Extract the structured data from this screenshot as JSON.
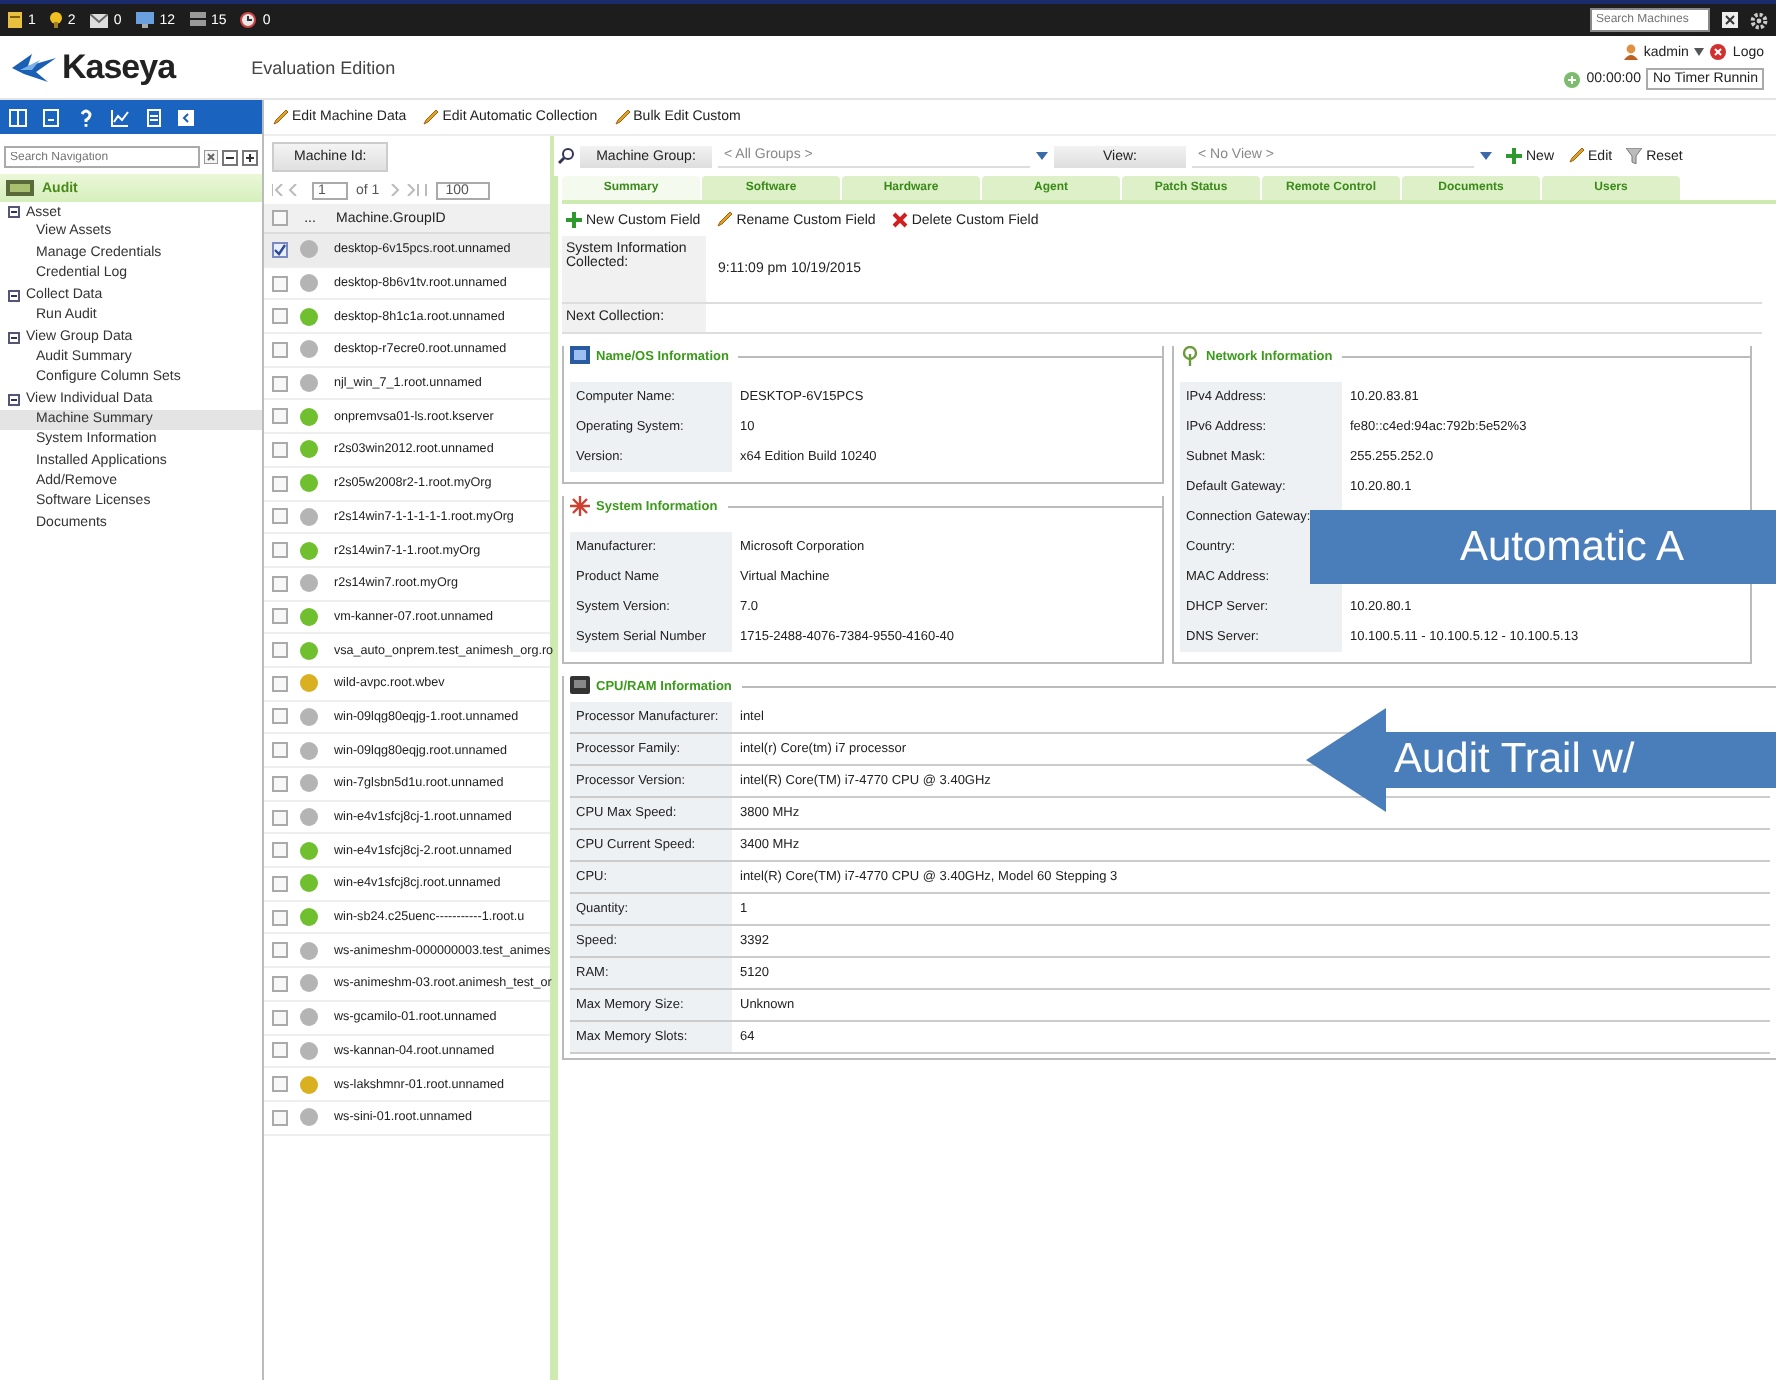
{
  "top_bar": {
    "counters": [
      {
        "kind": "note",
        "count": "1"
      },
      {
        "kind": "bulb",
        "count": "2"
      },
      {
        "kind": "mail",
        "count": "0"
      },
      {
        "kind": "monitor",
        "count": "12"
      },
      {
        "kind": "server",
        "count": "15"
      },
      {
        "kind": "alarm",
        "count": "0"
      }
    ],
    "search": {
      "placeholder": "Search Machines"
    }
  },
  "header": {
    "logo": "Kaseya",
    "edition": "Evaluation Edition",
    "user": "kadmin",
    "logout": "Logo",
    "timer": "00:00:00",
    "timer_status": "No Timer Runnin"
  },
  "toolbar": [
    {
      "label": "Edit Machine Data",
      "kind": "edit"
    },
    {
      "label": "Edit Automatic Collection",
      "kind": "edit"
    },
    {
      "label": "Bulk Edit Custom",
      "kind": "edit"
    }
  ],
  "navigation": {
    "search": {
      "placeholder": "Search Navigation"
    },
    "module": "Audit",
    "items": [
      {
        "label": "Asset",
        "expanded": true,
        "children": [
          {
            "label": "View Assets",
            "selected": false
          },
          {
            "label": "Manage Credentials",
            "selected": false
          },
          {
            "label": "Credential Log",
            "selected": false
          }
        ]
      },
      {
        "label": "Collect Data",
        "expanded": true,
        "children": [
          {
            "label": "Run Audit",
            "selected": false
          }
        ]
      },
      {
        "label": "View Group Data",
        "expanded": true,
        "children": [
          {
            "label": "Audit Summary",
            "selected": false
          },
          {
            "label": "Configure Column Sets",
            "selected": false
          }
        ]
      },
      {
        "label": "View Individual Data",
        "expanded": true,
        "children": [
          {
            "label": "Machine Summary",
            "selected": true
          },
          {
            "label": "System Information",
            "selected": false
          },
          {
            "label": "Installed Applications",
            "selected": false
          },
          {
            "label": "Add/Remove",
            "selected": false
          },
          {
            "label": "Software Licenses",
            "selected": false
          },
          {
            "label": "Documents",
            "selected": false
          }
        ]
      }
    ]
  },
  "machine_list": {
    "filter_label": "Machine Id:",
    "page": "1",
    "page_count": "of 1",
    "page_size": "100",
    "all_checked": false,
    "columns": [
      "...",
      "Machine.GroupID"
    ],
    "rows": [
      {
        "name": "desktop-6v15pcs.root.unnamed",
        "checked": true,
        "selected": true,
        "color": "#b4b4b4"
      },
      {
        "name": "desktop-8b6v1tv.root.unnamed",
        "checked": false,
        "selected": false,
        "color": "#b4b4b4"
      },
      {
        "name": "desktop-8h1c1a.root.unnamed",
        "checked": false,
        "selected": false,
        "color": "#6fbf2e"
      },
      {
        "name": "desktop-r7ecre0.root.unnamed",
        "checked": false,
        "selected": false,
        "color": "#b4b4b4"
      },
      {
        "name": "njl_win_7_1.root.unnamed",
        "checked": false,
        "selected": false,
        "color": "#b4b4b4"
      },
      {
        "name": "onpremvsa01-ls.root.kserver",
        "checked": false,
        "selected": false,
        "color": "#6fbf2e"
      },
      {
        "name": "r2s03win2012.root.unnamed",
        "checked": false,
        "selected": false,
        "color": "#6fbf2e"
      },
      {
        "name": "r2s05w2008r2-1.root.myOrg",
        "checked": false,
        "selected": false,
        "color": "#6fbf2e"
      },
      {
        "name": "r2s14win7-1-1-1-1-1.root.myOrg",
        "checked": false,
        "selected": false,
        "color": "#b4b4b4"
      },
      {
        "name": "r2s14win7-1-1.root.myOrg",
        "checked": false,
        "selected": false,
        "color": "#6fbf2e"
      },
      {
        "name": "r2s14win7.root.myOrg",
        "checked": false,
        "selected": false,
        "color": "#b4b4b4"
      },
      {
        "name": "vm-kanner-07.root.unnamed",
        "checked": false,
        "selected": false,
        "color": "#6fbf2e"
      },
      {
        "name": "vsa_auto_onprem.test_animesh_org.ro",
        "checked": false,
        "selected": false,
        "color": "#6fbf2e"
      },
      {
        "name": "wild-avpc.root.wbev",
        "checked": false,
        "selected": false,
        "color": "#d8b020"
      },
      {
        "name": "win-09lqg80eqjg-1.root.unnamed",
        "checked": false,
        "selected": false,
        "color": "#b4b4b4"
      },
      {
        "name": "win-09lqg80eqjg.root.unnamed",
        "checked": false,
        "selected": false,
        "color": "#b4b4b4"
      },
      {
        "name": "win-7glsbn5d1u.root.unnamed",
        "checked": false,
        "selected": false,
        "color": "#b4b4b4"
      },
      {
        "name": "win-e4v1sfcj8cj-1.root.unnamed",
        "checked": false,
        "selected": false,
        "color": "#b4b4b4"
      },
      {
        "name": "win-e4v1sfcj8cj-2.root.unnamed",
        "checked": false,
        "selected": false,
        "color": "#6fbf2e"
      },
      {
        "name": "win-e4v1sfcj8cj.root.unnamed",
        "checked": false,
        "selected": false,
        "color": "#6fbf2e"
      },
      {
        "name": "win-sb24.c25uenc-----------1.root.u",
        "checked": false,
        "selected": false,
        "color": "#6fbf2e"
      },
      {
        "name": "ws-animeshm-000000003.test_animes",
        "checked": false,
        "selected": false,
        "color": "#b4b4b4"
      },
      {
        "name": "ws-animeshm-03.root.animesh_test_or",
        "checked": false,
        "selected": false,
        "color": "#b4b4b4"
      },
      {
        "name": "ws-gcamilo-01.root.unnamed",
        "checked": false,
        "selected": false,
        "color": "#b4b4b4"
      },
      {
        "name": "ws-kannan-04.root.unnamed",
        "checked": false,
        "selected": false,
        "color": "#b4b4b4"
      },
      {
        "name": "ws-lakshmnr-01.root.unnamed",
        "checked": false,
        "selected": false,
        "color": "#d8b020"
      },
      {
        "name": "ws-sini-01.root.unnamed",
        "checked": false,
        "selected": false,
        "color": "#b4b4b4"
      }
    ]
  },
  "filters": {
    "machine_group_label": "Machine Group:",
    "machine_group": "< All Groups >",
    "view_label": "View:",
    "view": "< No View >",
    "actions": [
      {
        "label": "New",
        "kind": "add"
      },
      {
        "label": "Edit",
        "kind": "edit"
      },
      {
        "label": "Reset",
        "kind": "reset"
      }
    ]
  },
  "tabs": [
    {
      "label": "Summary",
      "selected": true
    },
    {
      "label": "Software",
      "selected": false
    },
    {
      "label": "Hardware",
      "selected": false
    },
    {
      "label": "Agent",
      "selected": false
    },
    {
      "label": "Patch Status",
      "selected": false
    },
    {
      "label": "Remote Control",
      "selected": false
    },
    {
      "label": "Documents",
      "selected": false
    },
    {
      "label": "Users",
      "selected": false
    }
  ],
  "custom_field_actions": [
    {
      "label": "New Custom Field",
      "kind": "add"
    },
    {
      "label": "Rename Custom Field",
      "kind": "edit"
    },
    {
      "label": "Delete Custom Field",
      "kind": "delete"
    }
  ],
  "collection": [
    {
      "label": "System Information Collected:",
      "value": "9:11:09 pm 10/19/2015"
    },
    {
      "label": "Next Collection:"
    }
  ],
  "sections": {
    "left": [
      {
        "title": "Name/OS Information",
        "kind": "os",
        "fields": [
          {
            "label": "Computer Name:",
            "value": "DESKTOP-6V15PCS"
          },
          {
            "label": "Operating System:",
            "value": "10"
          },
          {
            "label": "Version:",
            "value": "x64 Edition  Build 10240"
          }
        ]
      },
      {
        "title": "System Information",
        "kind": "system",
        "fields": [
          {
            "label": "Manufacturer:",
            "value": "Microsoft Corporation"
          },
          {
            "label": "Product Name",
            "value": "Virtual Machine"
          },
          {
            "label": "System Version:",
            "value": "7.0"
          },
          {
            "label": "System Serial Number",
            "value": "1715-2488-4076-7384-9550-4160-40"
          }
        ]
      }
    ],
    "right": [
      {
        "title": "Network Information",
        "kind": "network",
        "fields": [
          {
            "label": "IPv4 Address:",
            "value": "10.20.83.81"
          },
          {
            "label": "IPv6 Address:",
            "value": "fe80::c4ed:94ac:792b:5e52%3"
          },
          {
            "label": "Subnet Mask:",
            "value": "255.255.252.0"
          },
          {
            "label": "Default Gateway:",
            "value": "10.20.80.1"
          },
          {
            "label": "Connection Gateway:"
          },
          {
            "label": "Country:"
          },
          {
            "label": "MAC Address:"
          },
          {
            "label": "DHCP Server:",
            "value": "10.20.80.1"
          },
          {
            "label": "DNS Server:",
            "value": "10.100.5.11 - 10.100.5.12 - 10.100.5.13"
          }
        ]
      }
    ],
    "full": [
      {
        "title": "CPU/RAM Information",
        "kind": "cpu",
        "fields": [
          {
            "label": "Processor Manufacturer:",
            "value": "intel"
          },
          {
            "label": "Processor Family:",
            "value": "intel(r) Core(tm) i7 processor"
          },
          {
            "label": "Processor Version:",
            "value": "intel(R) Core(TM) i7-4770 CPU @ 3.40GHz"
          },
          {
            "label": "CPU Max Speed:",
            "value": "3800 MHz"
          },
          {
            "label": "CPU Current Speed:",
            "value": "3400 MHz"
          },
          {
            "label": "CPU:",
            "value": "intel(R) Core(TM) i7-4770 CPU @ 3.40GHz,  Model 60 Stepping 3"
          },
          {
            "label": "Quantity:",
            "value": "1"
          },
          {
            "label": "Speed:",
            "value": "3392"
          },
          {
            "label": "RAM:",
            "value": "5120"
          },
          {
            "label": "Max Memory Size:",
            "value": "Unknown"
          },
          {
            "label": "Max Memory Slots:",
            "value": "64"
          }
        ]
      }
    ]
  },
  "callouts": [
    {
      "kind": "box",
      "text": "Automatic A"
    },
    {
      "kind": "arrow",
      "text": "Audit Trail w/"
    }
  ]
}
